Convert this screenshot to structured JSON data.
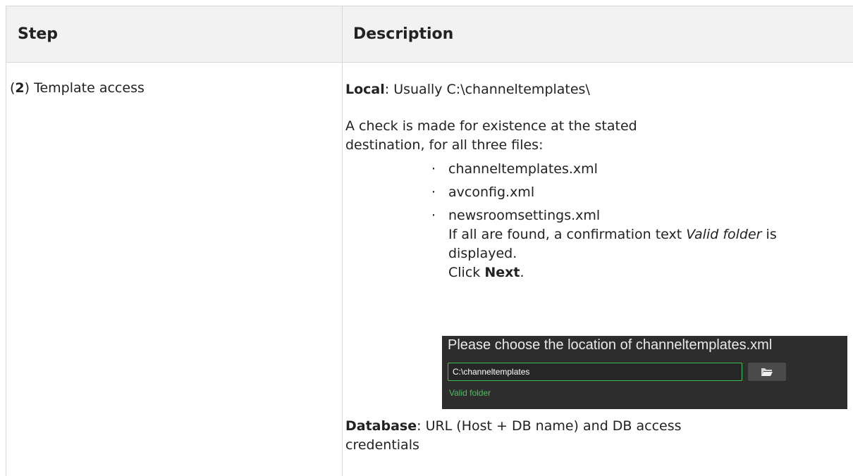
{
  "table": {
    "headers": {
      "step": "Step",
      "description": "Description"
    }
  },
  "row": {
    "step_paren_open": "(",
    "step_number": "2",
    "step_rest": ") Template access",
    "local_label": "Local",
    "local_text": ": Usually C:\\channeltemplates\\",
    "check_text": "A check is made for existence at the stated destination, for all three files:",
    "files": [
      "channeltemplates.xml",
      "avconfig.xml",
      "newsroomsettings.xml"
    ],
    "bullet": "·",
    "found_prefix": "If  all are found, a confirmation text ",
    "found_italic": "Valid folder",
    "found_suffix": " is displayed.",
    "click_prefix": "Click ",
    "click_label": "Next",
    "click_suffix": ".",
    "db_label": "Database",
    "db_text": ": URL (Host + DB name) and DB access credentials"
  },
  "dialog": {
    "title": "Please choose the location of channeltemplates.xml",
    "path_value": "C:\\channeltemplates",
    "browse_icon": "folder-open-icon",
    "status": "Valid folder",
    "colors": {
      "background": "#2d2d2d",
      "accent": "#3fbf5a",
      "status": "#4cc15f"
    }
  }
}
